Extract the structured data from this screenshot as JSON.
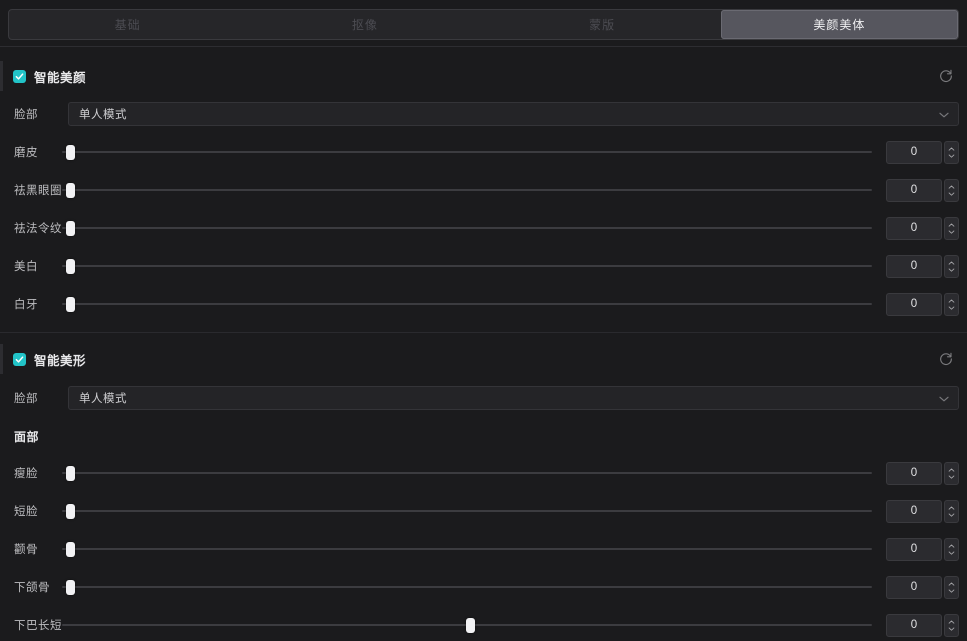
{
  "tabs": [
    {
      "label": "基础",
      "active": false
    },
    {
      "label": "抠像",
      "active": false
    },
    {
      "label": "蒙版",
      "active": false
    },
    {
      "label": "美颜美体",
      "active": true
    }
  ],
  "colors": {
    "accent": "#22c4c8",
    "panel_bg": "#1b1b1d",
    "tab_active_bg": "#56565e",
    "handle": "#f2f2f4"
  },
  "icons": {
    "reset": "reset-icon",
    "chevron_down": "chevron-down-icon",
    "check": "check-icon",
    "spinner_up": "chevron-up-icon",
    "spinner_down": "chevron-down-icon"
  },
  "sections": [
    {
      "title": "智能美颜",
      "checked": true,
      "reset_label": "重置",
      "select": {
        "label": "脸部",
        "value": "单人模式"
      },
      "sliders": [
        {
          "label": "磨皮",
          "value": "0",
          "percent": 0
        },
        {
          "label": "祛黑眼圈",
          "value": "0",
          "percent": 0
        },
        {
          "label": "祛法令纹",
          "value": "0",
          "percent": 0
        },
        {
          "label": "美白",
          "value": "0",
          "percent": 0
        },
        {
          "label": "白牙",
          "value": "0",
          "percent": 0
        }
      ]
    },
    {
      "title": "智能美形",
      "checked": true,
      "reset_label": "重置",
      "select": {
        "label": "脸部",
        "value": "单人模式"
      },
      "subheading": "面部",
      "sliders": [
        {
          "label": "瘦脸",
          "value": "0",
          "percent": 0
        },
        {
          "label": "短脸",
          "value": "0",
          "percent": 0
        },
        {
          "label": "颧骨",
          "value": "0",
          "percent": 0
        },
        {
          "label": "下颌骨",
          "value": "0",
          "percent": 0
        },
        {
          "label": "下巴长短",
          "value": "0",
          "percent": 50
        }
      ]
    }
  ]
}
